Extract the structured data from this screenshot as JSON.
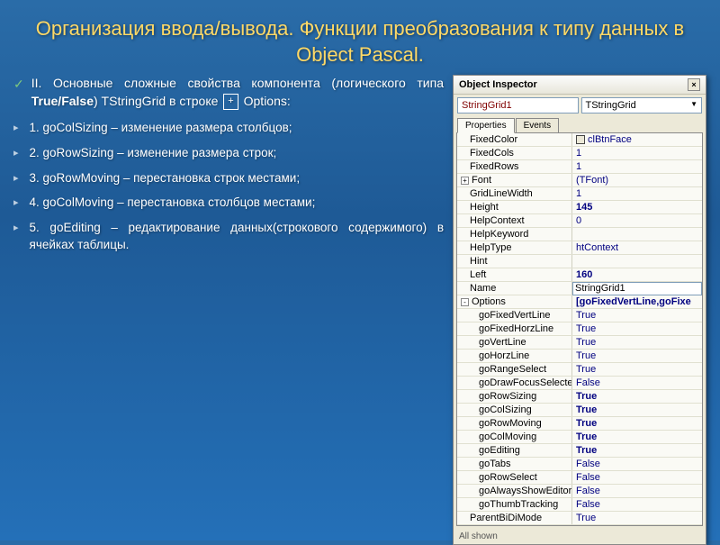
{
  "title": "Организация ввода/вывода.  Функции преобразования к типу данных в Object Pascal.",
  "main_bullet": {
    "pre": "II. Основные сложные свойства компонента (логического типа ",
    "bold": "True/False",
    "post": ") TStringGrid в строке ",
    "box": "+",
    "end": " Options:"
  },
  "items": [
    "1. goColSizing – изменение размера столбцов;",
    "2. goRowSizing – изменение размера строк;",
    "3. goRowMoving – перестановка строк местами;",
    "4. goColMoving – перестановка столбцов местами;",
    "5. goEditing – редактирование данных(строкового содержимого) в ячейках таблицы."
  ],
  "inspector": {
    "title": "Object Inspector",
    "component": "StringGrid1",
    "class": "TStringGrid",
    "tabs": [
      "Properties",
      "Events"
    ],
    "status": "All shown",
    "props": [
      {
        "n": "FixedColor",
        "v": "clBtnFace",
        "color": true
      },
      {
        "n": "FixedCols",
        "v": "1"
      },
      {
        "n": "FixedRows",
        "v": "1"
      },
      {
        "n": "Font",
        "v": "(TFont)",
        "exp": "+"
      },
      {
        "n": "GridLineWidth",
        "v": "1"
      },
      {
        "n": "Height",
        "v": "145",
        "bold": true
      },
      {
        "n": "HelpContext",
        "v": "0"
      },
      {
        "n": "HelpKeyword",
        "v": ""
      },
      {
        "n": "HelpType",
        "v": "htContext"
      },
      {
        "n": "Hint",
        "v": ""
      },
      {
        "n": "Left",
        "v": "160",
        "bold": true
      },
      {
        "n": "Name",
        "v": "StringGrid1",
        "edit": true
      },
      {
        "n": "Options",
        "v": "[goFixedVertLine,goFixe",
        "exp": "-",
        "bold": true
      },
      {
        "n": "goFixedVertLine",
        "v": "True",
        "indent": true
      },
      {
        "n": "goFixedHorzLine",
        "v": "True",
        "indent": true
      },
      {
        "n": "goVertLine",
        "v": "True",
        "indent": true
      },
      {
        "n": "goHorzLine",
        "v": "True",
        "indent": true
      },
      {
        "n": "goRangeSelect",
        "v": "True",
        "indent": true
      },
      {
        "n": "goDrawFocusSelected",
        "v": "False",
        "indent": true
      },
      {
        "n": "goRowSizing",
        "v": "True",
        "indent": true,
        "bold": true
      },
      {
        "n": "goColSizing",
        "v": "True",
        "indent": true,
        "bold": true
      },
      {
        "n": "goRowMoving",
        "v": "True",
        "indent": true,
        "bold": true
      },
      {
        "n": "goColMoving",
        "v": "True",
        "indent": true,
        "bold": true
      },
      {
        "n": "goEditing",
        "v": "True",
        "indent": true,
        "bold": true
      },
      {
        "n": "goTabs",
        "v": "False",
        "indent": true
      },
      {
        "n": "goRowSelect",
        "v": "False",
        "indent": true
      },
      {
        "n": "goAlwaysShowEditor",
        "v": "False",
        "indent": true
      },
      {
        "n": "goThumbTracking",
        "v": "False",
        "indent": true
      },
      {
        "n": "ParentBiDiMode",
        "v": "True"
      }
    ]
  }
}
